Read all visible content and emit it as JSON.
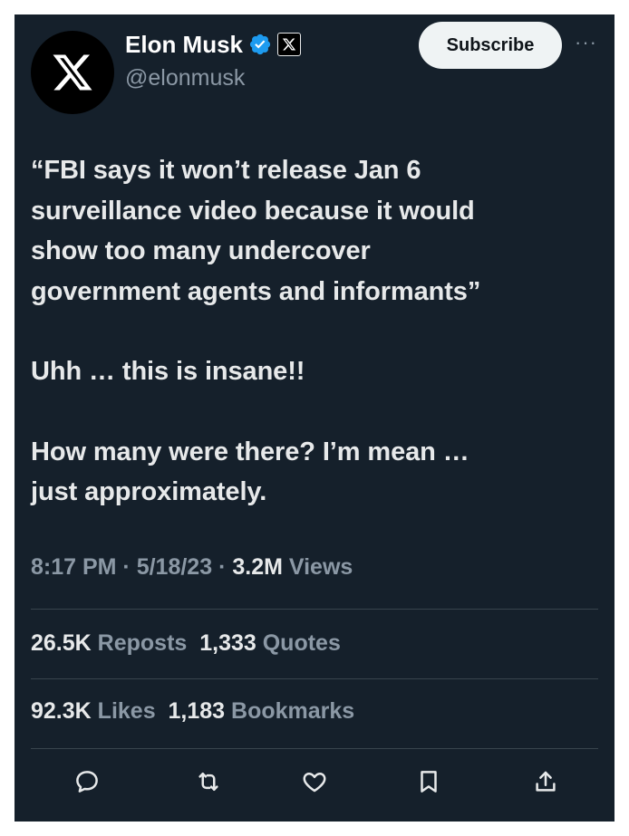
{
  "author": {
    "avatar_icon": "x-logo-icon",
    "display_name": "Elon Musk",
    "handle": "@elonmusk",
    "verified_icon": "verified-badge-icon",
    "affiliate_icon": "x-affiliate-icon"
  },
  "subscribe_label": "Subscribe",
  "more_label": "···",
  "tweet": {
    "quote_lines": [
      "“FBI says it won’t release Jan 6",
      "surveillance video because it would",
      "show too many undercover",
      "government agents and informants”"
    ],
    "line2": "Uhh … this is insane!!",
    "line3a": "How many were there? I’m mean …",
    "line3b": "just approximately."
  },
  "meta": {
    "time": "8:17 PM",
    "sep1": " · ",
    "date": "5/18/23",
    "sep2": " · ",
    "views_count": "3.2M",
    "views_label": "Views"
  },
  "stats": {
    "reposts_count": "26.5K",
    "reposts_label": "Reposts",
    "quotes_count": "1,333",
    "quotes_label": "Quotes",
    "likes_count": "92.3K",
    "likes_label": "Likes",
    "bookmarks_count": "1,183",
    "bookmarks_label": "Bookmarks"
  },
  "actions": [
    "reply-icon",
    "repost-icon",
    "like-icon",
    "bookmark-icon",
    "share-icon"
  ],
  "colors": {
    "background": "#15202b",
    "text": "#e7e9ea",
    "muted": "#8b98a5",
    "divider": "#38444d",
    "verified": "#1d9bf0"
  }
}
